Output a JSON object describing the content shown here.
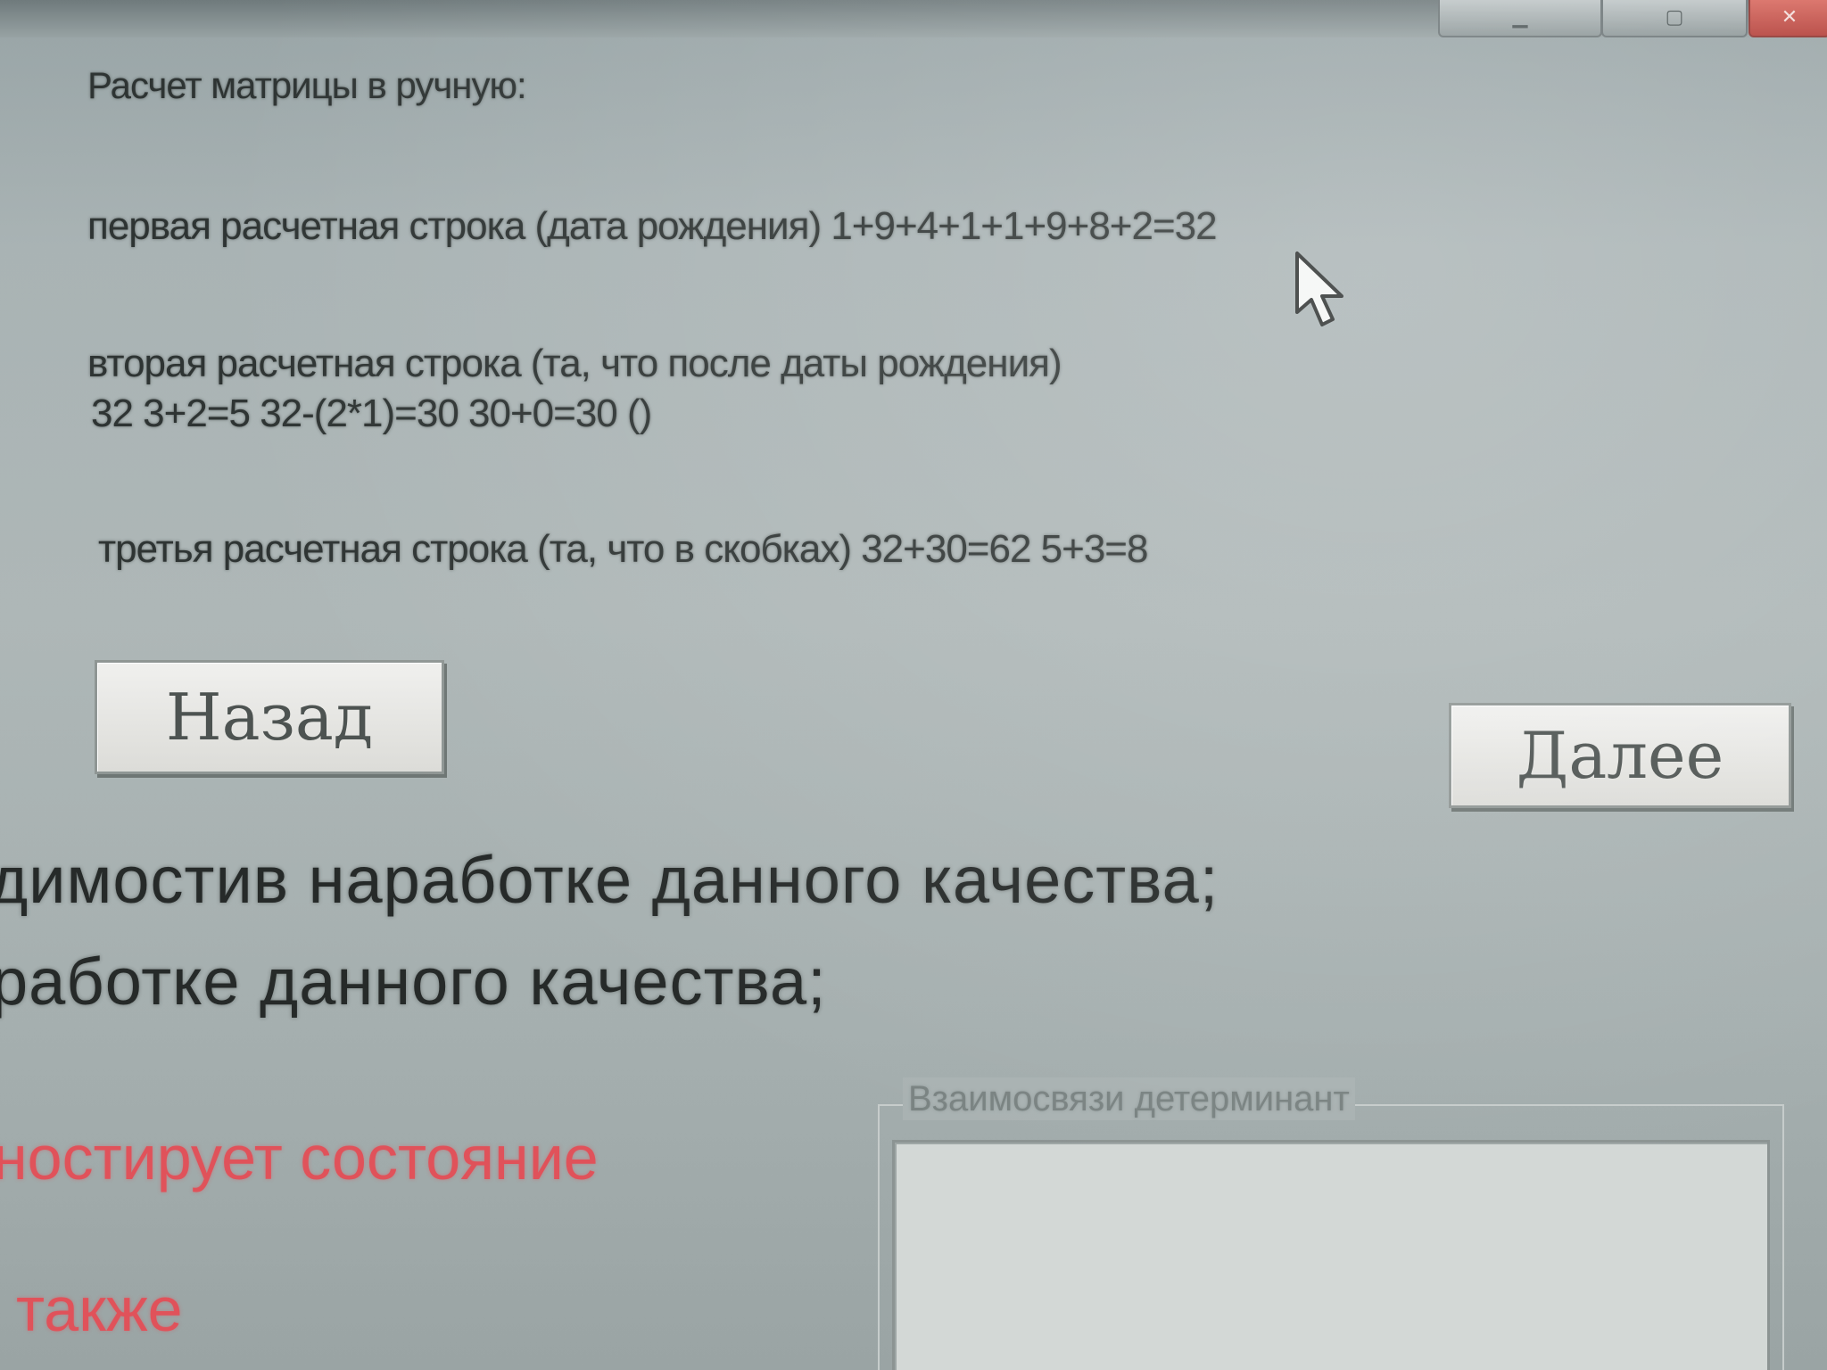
{
  "window": {
    "close_glyph": "✕"
  },
  "calculation": {
    "heading": "Расчет матрицы в ручную:",
    "row1": "первая расчетная строка (дата рождения) 1+9+4+1+1+9+8+2=32",
    "row2_title": "вторая расчетная строка (та, что после даты рождения)",
    "row2_values": "32 3+2=5 32-(2*1)=30 30+0=30 ()",
    "row3": "третья расчетная строка (та, что в скобках) 32+30=62 5+3=8"
  },
  "buttons": {
    "back_label": "Назад",
    "next_label": "Далее"
  },
  "document": {
    "line1": "димостив наработке данного качества;",
    "line2": "работке данного качества;",
    "red_line1": "ностирует состояние",
    "red_line2": "также"
  },
  "groupbox": {
    "label": "Взаимосвязи детерминант",
    "value": ""
  },
  "colors": {
    "background": "#aeb7b7",
    "red_text": "#e0525a",
    "button_face": "#e8e8e4"
  }
}
